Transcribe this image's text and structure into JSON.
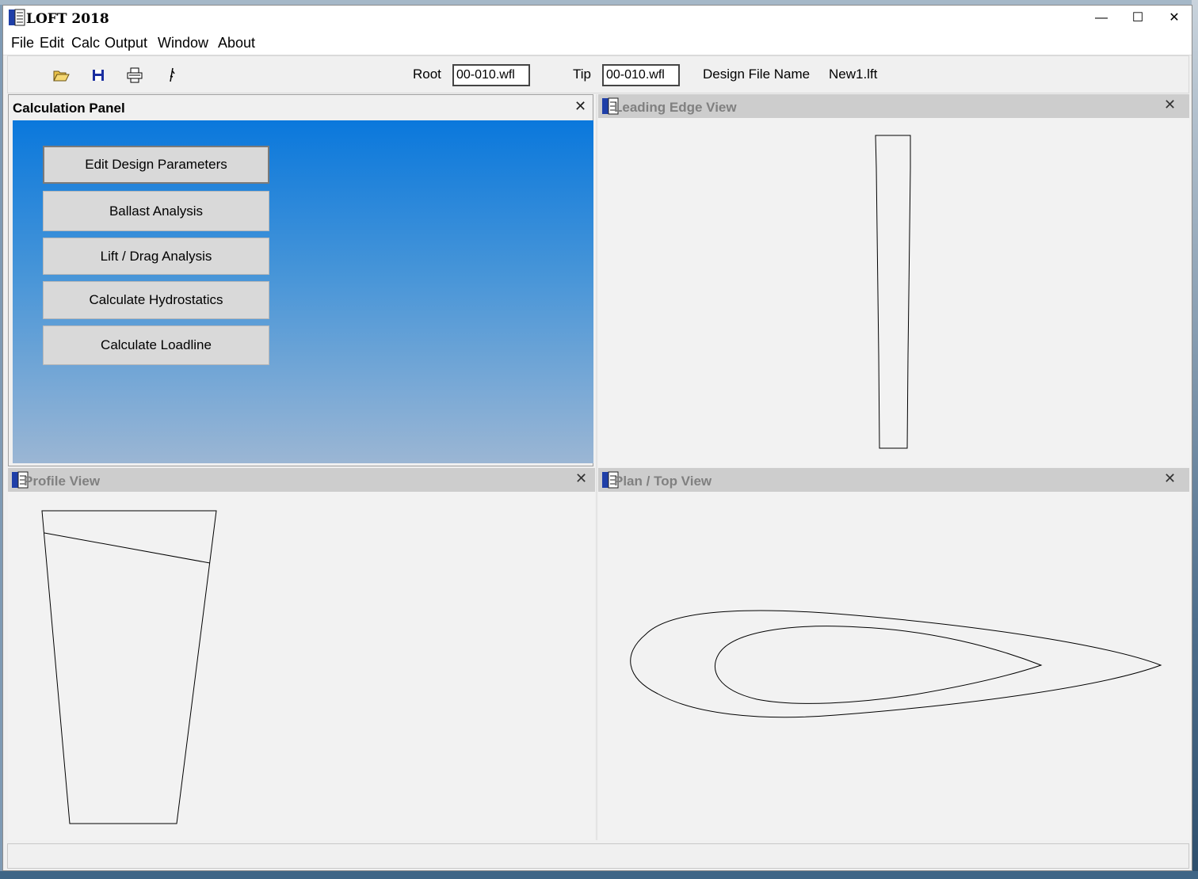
{
  "window": {
    "title": "LOFT 2018",
    "min_glyph": "—",
    "max_glyph": "☐",
    "close_glyph": "✕"
  },
  "menu": [
    "File",
    "Edit",
    "Calc",
    "Output",
    "Window",
    "About"
  ],
  "toolbar": {
    "icons": [
      "open-folder-icon",
      "save-disk-icon",
      "print-icon",
      "help-pointer-icon"
    ],
    "root_label": "Root",
    "root_value": "00-010.wfl",
    "tip_label": "Tip",
    "tip_value": "00-010.wfl",
    "design_file_label": "Design File Name",
    "design_file_value": "New1.lft"
  },
  "calc_panel": {
    "title": "Calculation Panel",
    "close_glyph": "✕",
    "buttons": [
      "Edit Design Parameters",
      "Ballast Analysis",
      "Lift / Drag Analysis",
      "Calculate Hydrostatics",
      "Calculate Loadline"
    ]
  },
  "views": {
    "leading_edge": {
      "title": "Leading Edge View",
      "close_glyph": "✕"
    },
    "profile": {
      "title": "Profile View",
      "close_glyph": "✕"
    },
    "plan": {
      "title": "Plan / Top View",
      "close_glyph": "✕"
    }
  },
  "colors": {
    "calc_gradient_top": "#0a78dc",
    "calc_gradient_bottom": "#9bb6d4",
    "view_header": "#cdcdcd"
  }
}
